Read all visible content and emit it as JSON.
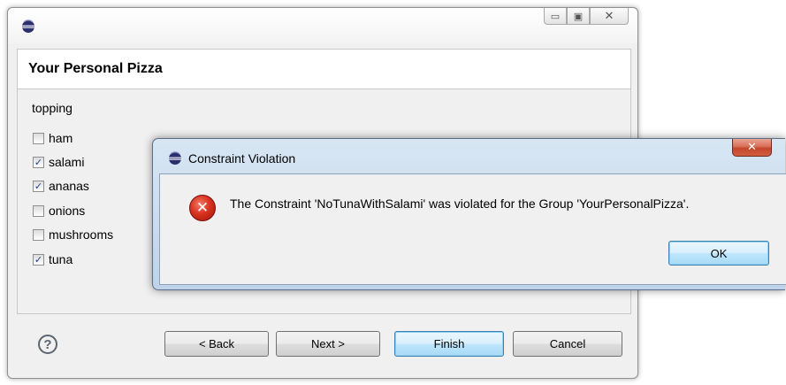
{
  "wizard": {
    "header_title": "Your Personal Pizza",
    "group_label": "topping",
    "toppings": [
      {
        "label": "ham",
        "checked": false
      },
      {
        "label": "salami",
        "checked": true
      },
      {
        "label": "ananas",
        "checked": true
      },
      {
        "label": "onions",
        "checked": false
      },
      {
        "label": "mushrooms",
        "checked": false
      },
      {
        "label": "tuna",
        "checked": true
      }
    ],
    "help_glyph": "?",
    "buttons": {
      "back": "< Back",
      "next": "Next >",
      "finish": "Finish",
      "cancel": "Cancel"
    }
  },
  "dialog": {
    "title": "Constraint Violation",
    "message": "The Constraint 'NoTunaWithSalami' was violated for the Group 'YourPersonalPizza'.",
    "ok_label": "OK"
  },
  "icons": {
    "app": "eclipse-icon",
    "error": "error-icon",
    "help": "help-icon",
    "minimize": "minimize-icon",
    "maximize": "maximize-icon",
    "close": "close-icon"
  }
}
